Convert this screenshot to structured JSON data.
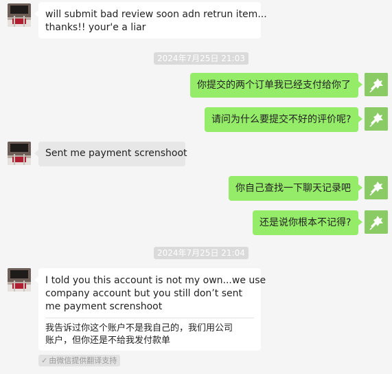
{
  "messages": [
    {
      "side": "left",
      "lines": [
        "will submit bad review soon adn retrun item...",
        "thanks!! your'e a liar"
      ]
    },
    {
      "type": "timestamp",
      "text": "2024年7月25日 21:03"
    },
    {
      "side": "right",
      "text": "你提交的两个订单我已经支付给你了"
    },
    {
      "side": "right",
      "text": "请问为什么要提交不好的评价呢?"
    },
    {
      "side": "left",
      "text": "Sent me payment screnshoot"
    },
    {
      "side": "right",
      "text": "你自己查找一下聊天记录吧"
    },
    {
      "side": "right",
      "text": "还是说你根本不记得?"
    },
    {
      "type": "timestamp",
      "text": "2024年7月25日 21:04"
    },
    {
      "side": "left",
      "original_lines": [
        "I told you this account is not my own...we use",
        "company account but you still don’t sent",
        "me payment screnshoot"
      ],
      "translation_lines": [
        "我告诉过你这个账户不是我自己的，我们用公司",
        "账户，但你还是不给我发付款单"
      ]
    }
  ],
  "translate_tag": {
    "check_icon": "✓",
    "label": "由微信提供翻译支持"
  },
  "colors": {
    "right_bubble": "#95ec69",
    "left_bubble": "#ffffff",
    "background": "#f5f5f5"
  }
}
